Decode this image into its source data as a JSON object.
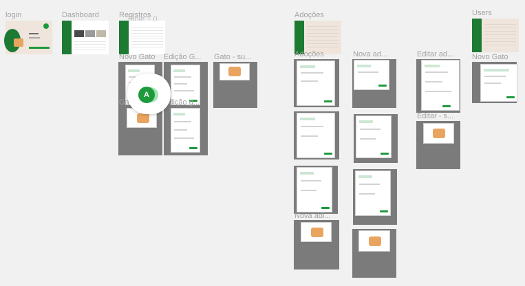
{
  "frames": {
    "login": "login",
    "dashboard": "Dashboard",
    "registros": "Registros",
    "registros_overlay": "Table 1.0",
    "adocoes": "Adoções",
    "users": "Users",
    "novo_gato": "Novo Gato",
    "edicao_g": "Edição G...",
    "gato_su": "Gato - su...",
    "nova_ad_1": "Nova ad...",
    "editar_ad": "Editar ad...",
    "editar_s": "Editar - s...",
    "novo_gato_users": "Novo Gato",
    "edicao_g2": "Edição g...",
    "gato_ga": "Ga...",
    "nova_adi": "Nova adi..."
  },
  "collaborator": {
    "initial": "A",
    "color": "#1e9a3c"
  },
  "colors": {
    "canvas": "#f1f1f1",
    "frame_gray": "#7b7b7b",
    "brand_green": "#1e9a3c",
    "login_bg": "#efe5dc"
  }
}
